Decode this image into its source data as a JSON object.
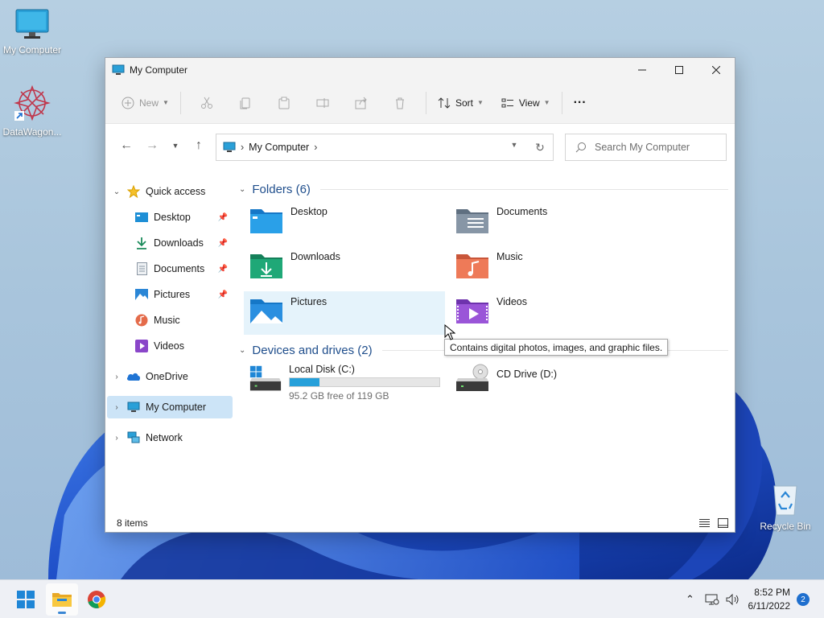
{
  "desktop": {
    "icons": [
      {
        "label": "My Computer",
        "icon": "computer-icon"
      },
      {
        "label": "DataWagon...",
        "icon": "datawagon-icon"
      },
      {
        "label": "Recycle Bin",
        "icon": "recycle-bin-icon"
      }
    ]
  },
  "window": {
    "title": "My Computer",
    "toolbar": {
      "new_label": "New",
      "sort_label": "Sort",
      "view_label": "View",
      "more_label": "···"
    },
    "address": {
      "segment": "My Computer"
    },
    "search": {
      "placeholder": "Search My Computer"
    },
    "sidebar": {
      "quick_access": "Quick access",
      "items": [
        {
          "label": "Desktop",
          "icon": "desktop-folder-icon",
          "pinned": true
        },
        {
          "label": "Downloads",
          "icon": "download-icon",
          "pinned": true
        },
        {
          "label": "Documents",
          "icon": "documents-icon",
          "pinned": true
        },
        {
          "label": "Pictures",
          "icon": "pictures-icon",
          "pinned": true
        },
        {
          "label": "Music",
          "icon": "music-icon",
          "pinned": false
        },
        {
          "label": "Videos",
          "icon": "videos-icon",
          "pinned": false
        }
      ],
      "onedrive": "OneDrive",
      "my_computer": "My Computer",
      "network": "Network"
    },
    "content": {
      "folders_header": "Folders (6)",
      "folders": [
        {
          "name": "Desktop",
          "icon": "desktop-folder-icon"
        },
        {
          "name": "Documents",
          "icon": "documents-folder-icon"
        },
        {
          "name": "Downloads",
          "icon": "downloads-folder-icon"
        },
        {
          "name": "Music",
          "icon": "music-folder-icon"
        },
        {
          "name": "Pictures",
          "icon": "pictures-folder-icon"
        },
        {
          "name": "Videos",
          "icon": "videos-folder-icon"
        }
      ],
      "drives_header": "Devices and drives (2)",
      "drives": [
        {
          "name": "Local Disk (C:)",
          "free": "95.2 GB free of 119 GB",
          "used_fraction": 0.2,
          "icon": "local-disk-icon"
        },
        {
          "name": "CD Drive (D:)",
          "icon": "cd-drive-icon"
        }
      ]
    },
    "tooltip": "Contains digital photos, images, and graphic files.",
    "status": {
      "items": "8 items"
    }
  },
  "taskbar": {
    "time": "8:52 PM",
    "date": "6/11/2022",
    "notification_count": "2"
  },
  "colors": {
    "accent": "#0078d4",
    "selection": "#cce4f7",
    "hover": "#e5f3fb",
    "group_header": "#1f4e8c",
    "drive_bar": "#26a0da"
  }
}
